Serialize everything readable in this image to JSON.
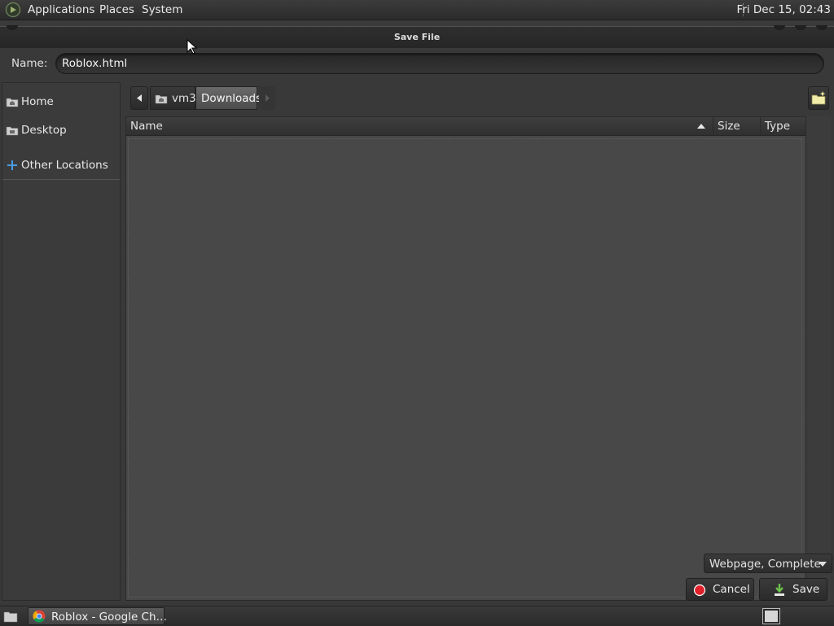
{
  "top_panel": {
    "menus": [
      "Applications",
      "Places",
      "System"
    ],
    "clock": "Fri Dec 15, 02:43"
  },
  "dialog": {
    "title": "Save File",
    "name_label": "Name:",
    "name_value": "Roblox.html"
  },
  "sidebar": {
    "items": [
      {
        "label": "Home",
        "icon": "home-folder-icon"
      },
      {
        "label": "Desktop",
        "icon": "desktop-folder-icon"
      },
      {
        "label": "Other Locations",
        "icon": "plus-icon"
      }
    ]
  },
  "pathbar": {
    "segments": [
      "vm3",
      "Downloads"
    ],
    "active": "Downloads"
  },
  "filelist": {
    "columns": [
      "Name",
      "Size",
      "Type"
    ],
    "sort_column": "Name",
    "sort_direction": "ascending",
    "rows": []
  },
  "filter": {
    "selected": "Webpage, Complete"
  },
  "actions": {
    "cancel_label": "Cancel",
    "save_label": "Save"
  },
  "taskbar": {
    "window_label": "Roblox - Google Ch…"
  },
  "colors": {
    "background": "#393939",
    "panel": "#2b2b2b",
    "active_path": "#5a5a5a",
    "cancel_icon": "#e0202a",
    "save_icon": "#6cc24a"
  }
}
